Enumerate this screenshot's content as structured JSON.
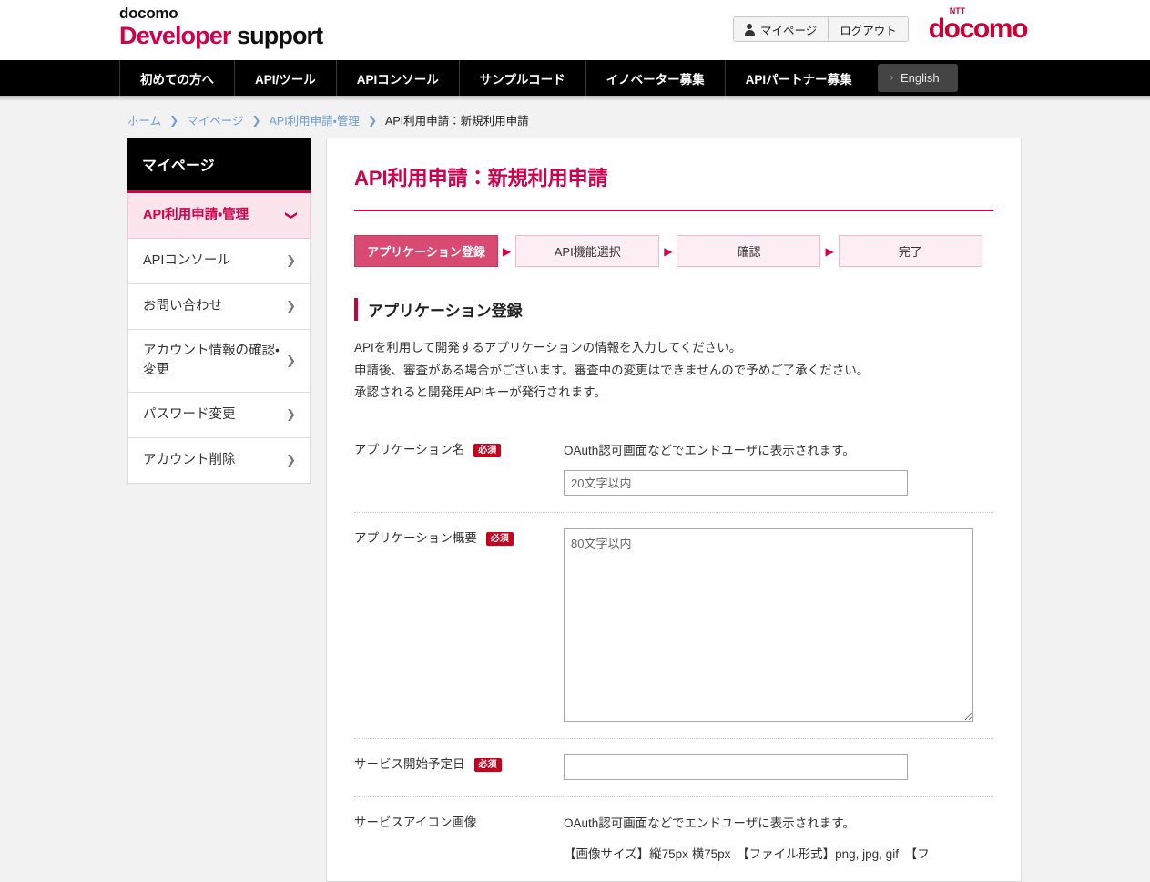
{
  "header": {
    "logo_small": "docomo",
    "logo_dev": "Developer",
    "logo_support": " support",
    "mypage_label": "マイページ",
    "logout_label": "ログアウト",
    "brand_ntt": "NTT",
    "brand_docomo": "docomo",
    "brand_color": "#cc0033"
  },
  "nav": {
    "items": [
      {
        "label": "初めての方へ"
      },
      {
        "label": "API/ツール"
      },
      {
        "label": "APIコンソール"
      },
      {
        "label": "サンプルコード"
      },
      {
        "label": "イノベーター募集"
      },
      {
        "label": "APIパートナー募集"
      }
    ],
    "lang_chevron": "›",
    "lang_label": "English"
  },
  "breadcrumb": {
    "items": [
      {
        "label": "ホーム",
        "current": false
      },
      {
        "label": "マイページ",
        "current": false
      },
      {
        "label": "API利用申請・管理",
        "current": false
      },
      {
        "label": "API利用申請：新規利用申請",
        "current": true
      }
    ],
    "separator": "❯"
  },
  "sidebar": {
    "heading": "マイページ",
    "items": [
      {
        "label": "API利用申請・管理",
        "arrow": "❯",
        "active": true
      },
      {
        "label": "APIコンソール",
        "arrow": "❯",
        "active": false
      },
      {
        "label": "お問い合わせ",
        "arrow": "❯",
        "active": false
      },
      {
        "label": "アカウント情報の確認・変更",
        "arrow": "❯",
        "active": false
      },
      {
        "label": "パスワード変更",
        "arrow": "❯",
        "active": false
      },
      {
        "label": "アカウント削除",
        "arrow": "❯",
        "active": false
      }
    ],
    "accent_color": "#d2004b"
  },
  "main": {
    "page_title": "API利用申請：新規利用申請",
    "steps": [
      {
        "label": "アプリケーション登録",
        "active": true
      },
      {
        "label": "API機能選択",
        "active": false
      },
      {
        "label": "確認",
        "active": false
      },
      {
        "label": "完了",
        "active": false
      }
    ],
    "step_arrow": "▶",
    "section_heading": "アプリケーション登録",
    "description_lines": [
      "APIを利用して開発するアプリケーションの情報を入力してください。",
      "申請後、審査がある場合がございます。審査中の変更はできませんので予めご了承ください。",
      "承認されると開発用APIキーが発行されます。"
    ],
    "required_badge": "必須",
    "form": {
      "app_name": {
        "label": "アプリケーション名",
        "required": true,
        "note": "OAuth認可画面などでエンドユーザに表示されます。",
        "value": "",
        "placeholder": "20文字以内"
      },
      "app_summary": {
        "label": "アプリケーション概要",
        "required": true,
        "value": "",
        "placeholder": "80文字以内"
      },
      "service_start_date": {
        "label": "サービス開始予定日",
        "required": true,
        "value": "",
        "placeholder": ""
      },
      "service_icon": {
        "label": "サービスアイコン画像",
        "required": false,
        "note_1": "OAuth認可画面などでエンドユーザに表示されます。",
        "note_2": "【画像サイズ】縦75px 横75px　【ファイル形式】png, jpg, gif　【フ"
      }
    }
  }
}
